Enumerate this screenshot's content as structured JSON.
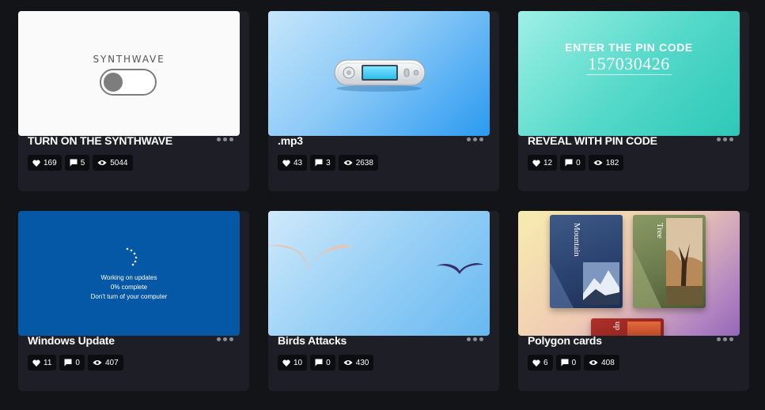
{
  "cards": [
    {
      "title": "TURN ON THE SYNTHWAVE",
      "thumb_text": "SYNTHWAVE",
      "stats": {
        "likes": "169",
        "comments": "5",
        "views": "5044"
      }
    },
    {
      "title": ".mp3",
      "stats": {
        "likes": "43",
        "comments": "3",
        "views": "2638"
      }
    },
    {
      "title": "REVEAL WITH PIN CODE",
      "thumb_heading": "ENTER THE PIN CODE",
      "thumb_code": "157030426",
      "stats": {
        "likes": "12",
        "comments": "0",
        "views": "182"
      }
    },
    {
      "title": "Windows Update",
      "thumb_lines": [
        "Working on updates",
        "0% complete",
        "Don't turn of your computer"
      ],
      "stats": {
        "likes": "11",
        "comments": "0",
        "views": "407"
      }
    },
    {
      "title": "Birds Attacks",
      "stats": {
        "likes": "10",
        "comments": "0",
        "views": "430"
      }
    },
    {
      "title": "Polygon cards",
      "thumb_labels": [
        "Mountain",
        "Tree",
        "up"
      ],
      "stats": {
        "likes": "6",
        "comments": "0",
        "views": "408"
      }
    }
  ],
  "icons": {
    "like": "heart-icon",
    "comment": "comment-icon",
    "view": "eye-icon",
    "more": "more-options-icon"
  },
  "colors": {
    "page_bg": "#131417",
    "card_bg": "#1e1f26",
    "stat_bg": "#0c0d10",
    "windows_blue": "#0458a6"
  }
}
